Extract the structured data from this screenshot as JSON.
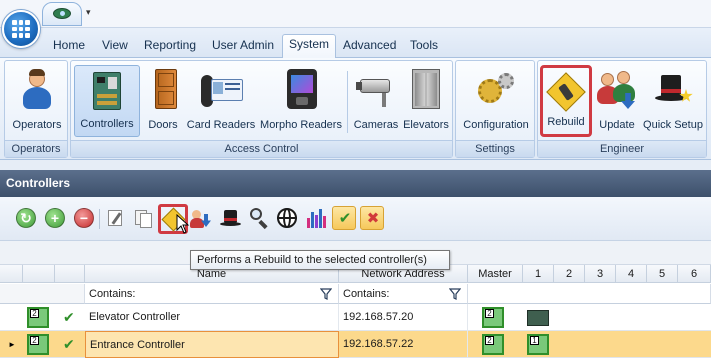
{
  "ribbon": {
    "tabs": [
      "Home",
      "View",
      "Reporting",
      "User Admin",
      "System",
      "Advanced",
      "Tools"
    ],
    "active_tab": "System",
    "groups": [
      {
        "label": "Operators",
        "buttons": [
          "Operators"
        ]
      },
      {
        "label": "Access Control",
        "buttons": [
          "Controllers",
          "Doors",
          "Card Readers",
          "Morpho Readers",
          "Cameras",
          "Elevators"
        ]
      },
      {
        "label": "Settings",
        "buttons": [
          "Configuration"
        ]
      },
      {
        "label": "Engineer",
        "buttons": [
          "Rebuild",
          "Update",
          "Quick Setup"
        ]
      }
    ]
  },
  "panel": {
    "title": "Controllers"
  },
  "tooltip": {
    "text": "Performs a Rebuild to the selected controller(s)"
  },
  "grid": {
    "headers": {
      "name": "Name",
      "address": "Network Address",
      "master": "Master",
      "ports": [
        "1",
        "2",
        "3",
        "4",
        "5",
        "6"
      ]
    },
    "filter": {
      "name_label": "Contains:",
      "address_label": "Contains:"
    },
    "rows": [
      {
        "name": "Elevator Controller",
        "address": "192.168.57.20",
        "master_num": "2",
        "port1": "chip"
      },
      {
        "name": "Entrance Controller",
        "address": "192.168.57.22",
        "master_num": "2",
        "port1_num": "1"
      }
    ]
  },
  "colors": {
    "highlight_red": "#d03a42",
    "selected_row": "#fcd98c",
    "panel_header": "#4a5d7a"
  }
}
